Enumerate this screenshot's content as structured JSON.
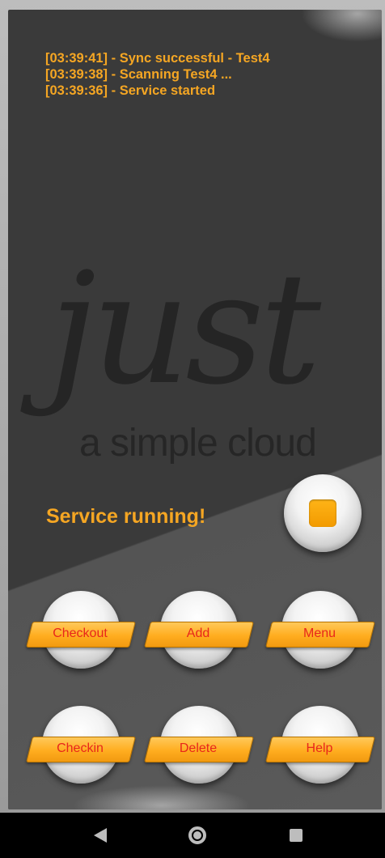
{
  "log": [
    "[03:39:41] - Sync successful - Test4",
    "[03:39:38] - Scanning Test4 ...",
    "[03:39:36] - Service started"
  ],
  "watermark": {
    "script": "just",
    "caption": "a simple cloud"
  },
  "status": {
    "text": "Service running!"
  },
  "stop_button": {
    "icon": "stop-icon"
  },
  "actions": {
    "row1": [
      "Checkout",
      "Add",
      "Menu"
    ],
    "row2": [
      "Checkin",
      "Delete",
      "Help"
    ]
  },
  "navbar": {
    "icons": [
      "back-icon",
      "home-icon",
      "recent-apps-icon"
    ]
  },
  "colors": {
    "accent": "#f5a623",
    "button_label": "#e8261b",
    "background": "#3a3a3a"
  }
}
